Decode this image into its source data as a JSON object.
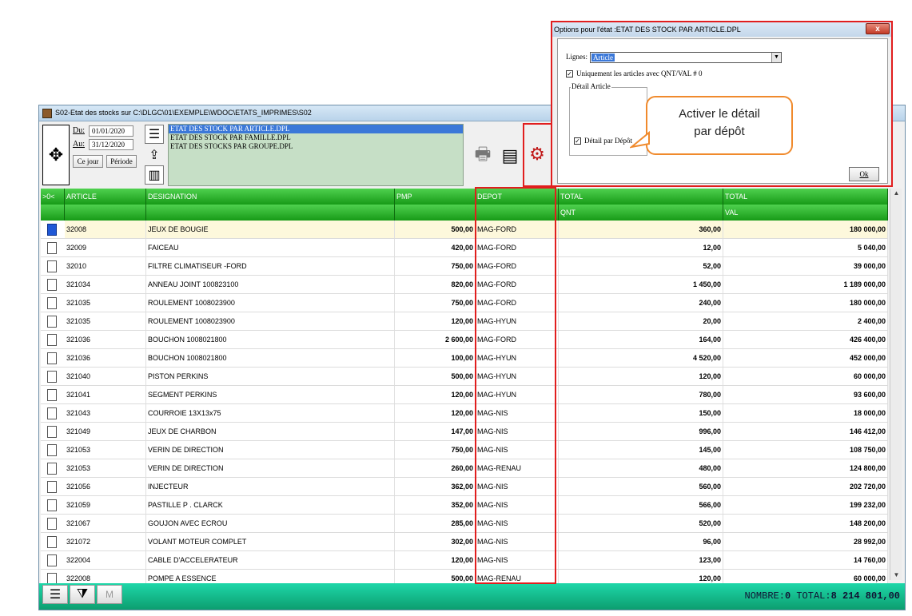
{
  "main_window": {
    "title": "S02-Etat des stocks sur C:\\DLGC\\01\\EXEMPLE\\WDOC\\ETATS_IMPRIMES\\S02"
  },
  "toolbar": {
    "du_label": "Du:",
    "du_value": "01/01/2020",
    "au_label": "Au:",
    "au_value": "31/12/2020",
    "ce_jour_label": "Ce jour",
    "periode_label": "Période",
    "reports": [
      "ETAT DES STOCK PAR ARTICLE.DPL",
      "ETAT DES STOCK PAR FAMILLE.DPL",
      "ETAT DES STOCKS PAR GROUPE.DPL"
    ]
  },
  "table": {
    "headers": [
      "ARTICLE",
      "DESIGNATION",
      "PMP",
      "DEPOT",
      "TOTAL",
      "TOTAL"
    ],
    "headers2": [
      "QNT",
      "VAL"
    ],
    "first_col": ">0<",
    "rows": [
      {
        "article": "32008",
        "designation": "JEUX DE BOUGIE",
        "pmp": "500,00",
        "depot": "MAG-FORD",
        "qnt": "360,00",
        "val": "180 000,00"
      },
      {
        "article": "32009",
        "designation": "FAICEAU",
        "pmp": "420,00",
        "depot": "MAG-FORD",
        "qnt": "12,00",
        "val": "5 040,00"
      },
      {
        "article": "32010",
        "designation": "FILTRE CLIMATISEUR -FORD",
        "pmp": "750,00",
        "depot": "MAG-FORD",
        "qnt": "52,00",
        "val": "39 000,00"
      },
      {
        "article": "321034",
        "designation": "ANNEAU JOINT 100823100",
        "pmp": "820,00",
        "depot": "MAG-FORD",
        "qnt": "1 450,00",
        "val": "1 189 000,00"
      },
      {
        "article": "321035",
        "designation": "ROULEMENT 1008023900",
        "pmp": "750,00",
        "depot": "MAG-FORD",
        "qnt": "240,00",
        "val": "180 000,00"
      },
      {
        "article": "321035",
        "designation": "ROULEMENT 1008023900",
        "pmp": "120,00",
        "depot": "MAG-HYUN",
        "qnt": "20,00",
        "val": "2 400,00"
      },
      {
        "article": "321036",
        "designation": "BOUCHON 1008021800",
        "pmp": "2 600,00",
        "depot": "MAG-FORD",
        "qnt": "164,00",
        "val": "426 400,00"
      },
      {
        "article": "321036",
        "designation": "BOUCHON 1008021800",
        "pmp": "100,00",
        "depot": "MAG-HYUN",
        "qnt": "4 520,00",
        "val": "452 000,00"
      },
      {
        "article": "321040",
        "designation": "PISTON  PERKINS",
        "pmp": "500,00",
        "depot": "MAG-HYUN",
        "qnt": "120,00",
        "val": "60 000,00"
      },
      {
        "article": "321041",
        "designation": "SEGMENT PERKINS",
        "pmp": "120,00",
        "depot": "MAG-HYUN",
        "qnt": "780,00",
        "val": "93 600,00"
      },
      {
        "article": "321043",
        "designation": "COURROIE 13X13x75",
        "pmp": "120,00",
        "depot": "MAG-NIS",
        "qnt": "150,00",
        "val": "18 000,00"
      },
      {
        "article": "321049",
        "designation": "JEUX DE CHARBON",
        "pmp": "147,00",
        "depot": "MAG-NIS",
        "qnt": "996,00",
        "val": "146 412,00"
      },
      {
        "article": "321053",
        "designation": "VERIN DE DIRECTION",
        "pmp": "750,00",
        "depot": "MAG-NIS",
        "qnt": "145,00",
        "val": "108 750,00"
      },
      {
        "article": "321053",
        "designation": "VERIN DE DIRECTION",
        "pmp": "260,00",
        "depot": "MAG-RENAU",
        "qnt": "480,00",
        "val": "124 800,00"
      },
      {
        "article": "321056",
        "designation": "INJECTEUR",
        "pmp": "362,00",
        "depot": "MAG-NIS",
        "qnt": "560,00",
        "val": "202 720,00"
      },
      {
        "article": "321059",
        "designation": "PASTILLE P . CLARCK",
        "pmp": "352,00",
        "depot": "MAG-NIS",
        "qnt": "566,00",
        "val": "199 232,00"
      },
      {
        "article": "321067",
        "designation": "GOUJON AVEC ECROU",
        "pmp": "285,00",
        "depot": "MAG-NIS",
        "qnt": "520,00",
        "val": "148 200,00"
      },
      {
        "article": "321072",
        "designation": "VOLANT MOTEUR COMPLET",
        "pmp": "302,00",
        "depot": "MAG-NIS",
        "qnt": "96,00",
        "val": "28 992,00"
      },
      {
        "article": "322004",
        "designation": "CABLE D'ACCELERATEUR",
        "pmp": "120,00",
        "depot": "MAG-NIS",
        "qnt": "123,00",
        "val": "14 760,00"
      },
      {
        "article": "322008",
        "designation": "POMPE A ESSENCE",
        "pmp": "500,00",
        "depot": "MAG-RENAU",
        "qnt": "120,00",
        "val": "60 000,00"
      }
    ]
  },
  "footer": {
    "m_label": "M",
    "nombre_label": "NOMBRE:",
    "nombre_value": "0",
    "total_label": "TOTAL:",
    "total_value": "8 214 801,00"
  },
  "dialog": {
    "title": "Options pour l'état :ETAT DES STOCK PAR ARTICLE.DPL",
    "close_label": "x",
    "lignes_label": "Lignes:",
    "lignes_value": "Article",
    "uniquement_label": "Uniquement les articles avec QNT/VAL # 0",
    "detail_group_label": "Détail Article",
    "detail_depot_label": "Détail par Dépôt",
    "ok_label": "Ok"
  },
  "callout": {
    "line1": "Activer le détail",
    "line2": "par dépôt"
  },
  "colors": {
    "header_green": "#179a17",
    "footer_teal": "#0c9e6f",
    "highlight_red": "#e11e1e",
    "callout_orange": "#f08a2c"
  }
}
